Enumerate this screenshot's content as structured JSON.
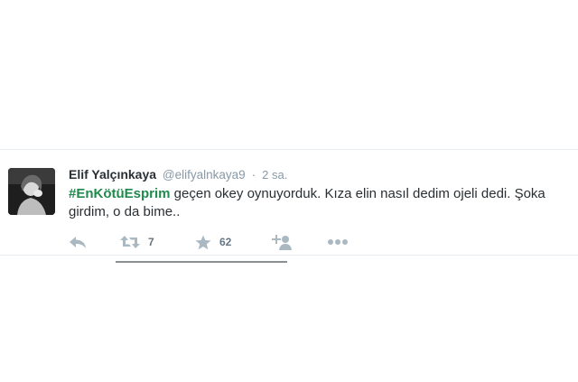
{
  "tweet": {
    "author_name": "Elif Yalçınkaya",
    "author_handle": "@elifyalnkaya9",
    "separator": "·",
    "time": "2 sa.",
    "hashtag": "#EnKötüEsprim",
    "text_rest": " geçen okey oynuyorduk. Kıza elin nasıl dedim ojeli dedi. Şoka girdim, o da bime..",
    "actions": {
      "reply_icon": "reply-icon",
      "retweet_icon": "retweet-icon",
      "retweet_count": "7",
      "favorite_icon": "star-icon",
      "favorite_count": "62",
      "follow_icon": "follow-icon",
      "more_icon": "more-icon"
    }
  },
  "colors": {
    "name": "#292f33",
    "meta": "#8899a6",
    "hashtag": "#1f8a4c",
    "icon": "#aab8c2"
  }
}
